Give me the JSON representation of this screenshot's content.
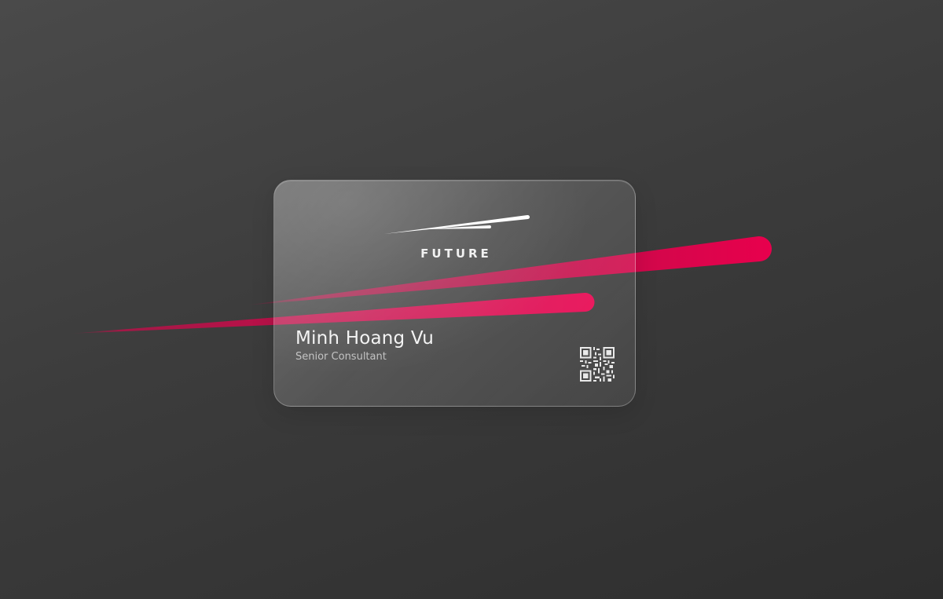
{
  "card": {
    "brand": "FUTURE",
    "name": "Minh Hoang Vu",
    "title": "Senior Consultant"
  },
  "colors": {
    "background": "#3c3c3c",
    "streak": "#e8004d",
    "text": "#f3f3f3"
  },
  "icons": {
    "logo": "swoosh-logo-icon",
    "qr": "qr-code-icon"
  }
}
